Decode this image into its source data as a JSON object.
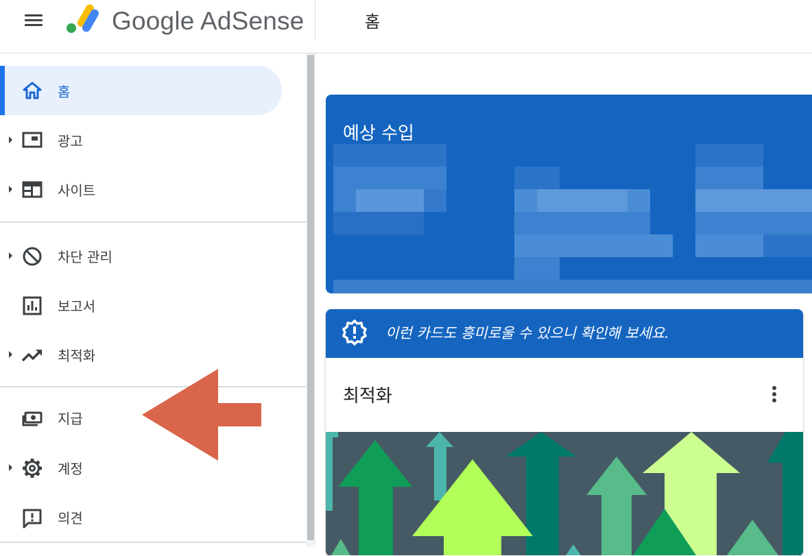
{
  "header": {
    "brand": "Google AdSense",
    "page_title": "홈",
    "icons": {
      "menu": "hamburger-menu-icon",
      "logo": "adsense-logo-icon"
    }
  },
  "sidebar": {
    "items": [
      {
        "label": "홈",
        "icon": "home-icon",
        "active": true,
        "expandable": false
      },
      {
        "label": "광고",
        "icon": "ads-icon",
        "active": false,
        "expandable": true
      },
      {
        "label": "사이트",
        "icon": "sites-icon",
        "active": false,
        "expandable": true
      },
      {
        "label": "차단 관리",
        "icon": "block-icon",
        "active": false,
        "expandable": true
      },
      {
        "label": "보고서",
        "icon": "reports-icon",
        "active": false,
        "expandable": false
      },
      {
        "label": "최적화",
        "icon": "trending-up-icon",
        "active": false,
        "expandable": true
      },
      {
        "label": "지급",
        "icon": "payments-icon",
        "active": false,
        "expandable": false
      },
      {
        "label": "계정",
        "icon": "settings-gear-icon",
        "active": false,
        "expandable": true
      },
      {
        "label": "의견",
        "icon": "feedback-icon",
        "active": false,
        "expandable": false
      }
    ]
  },
  "main": {
    "earnings_card": {
      "title": "예상 수입"
    },
    "suggestion_card": {
      "banner_text": "이런 카드도 흥미로울 수 있으니 확인해 보세요.",
      "banner_icon": "optimization-badge-icon",
      "title": "최적화",
      "menu_icon": "more-vert-icon"
    }
  },
  "annotation": {
    "icon": "left-arrow-annotation-icon",
    "color": "#d9654a"
  },
  "colors": {
    "accent": "#1a73e8",
    "card_blue": "#1565c0",
    "active_bg": "#e8f0fe"
  }
}
